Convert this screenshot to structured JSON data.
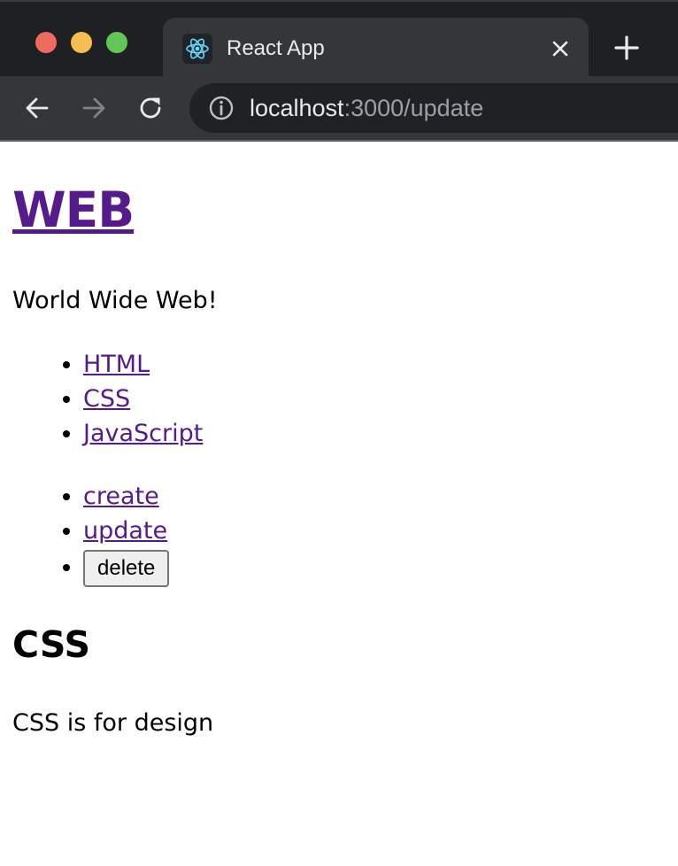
{
  "browser": {
    "tab": {
      "title": "React App",
      "favicon": "react-logo-icon"
    },
    "url": {
      "host": "localhost",
      "rest": ":3000/update"
    },
    "colors": {
      "tabstrip": "#1f2023",
      "toolbar": "#35363a",
      "omnibox": "#202124",
      "traffic_red": "#ee6a5f",
      "traffic_yellow": "#f5be4f",
      "traffic_green": "#62c655"
    }
  },
  "page": {
    "site_title": "WEB",
    "tagline": "World Wide Web!",
    "topics": [
      {
        "label": "HTML"
      },
      {
        "label": "CSS"
      },
      {
        "label": "JavaScript"
      }
    ],
    "controls": {
      "create_label": "create",
      "update_label": "update",
      "delete_label": "delete"
    },
    "article": {
      "title": "CSS",
      "body": "CSS is for design"
    },
    "colors": {
      "link": "#551a8b",
      "text": "#000000"
    }
  }
}
